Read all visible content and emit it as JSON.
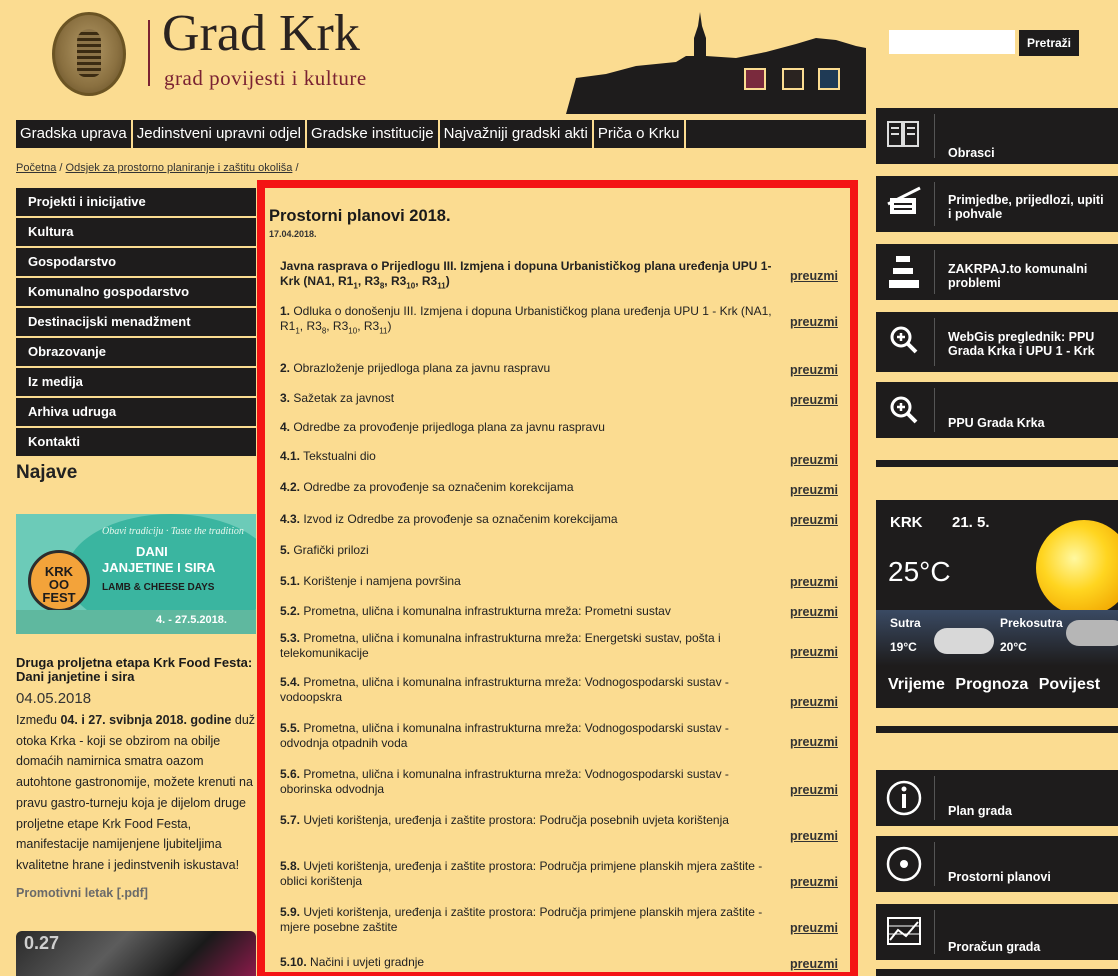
{
  "site": {
    "title": "Grad Krk",
    "subtitle": "grad povijesti i kulture",
    "theme_colors": [
      "#7a2a3d",
      "#2a2320",
      "#1f3a55"
    ]
  },
  "search": {
    "placeholder": "",
    "button_label": "Pretraži"
  },
  "topnav": [
    "Gradska uprava",
    "Jedinstveni upravni odjel",
    "Gradske institucije",
    "Najvažniji gradski akti",
    "Priča o Krku"
  ],
  "breadcrumb": {
    "home": "Početna",
    "section": "Odsjek za prostorno planiranje i zaštitu okoliša",
    "sep": " / ",
    "trail": " /"
  },
  "sidemenu": [
    "Projekti i inicijative",
    "Kultura",
    "Gospodarstvo",
    "Komunalno gospodarstvo",
    "Destinacijski menadžment",
    "Obrazovanje",
    "Iz medija",
    "Arhiva udruga",
    "Kontakti"
  ],
  "najave": {
    "heading": "Najave",
    "promo": {
      "script": "Obavi tradiciju · Taste the tradition",
      "line1": "DANI",
      "line2": "JANJETINE I SIRA",
      "line3": "LAMB & CHEESE DAYS",
      "pot": "KRK\nOO\nFEST",
      "dates": "4. - 27.5.2018."
    },
    "news_title": "Druga proljetna etapa Krk Food Festa: Dani janjetine i sira",
    "news_date": "04.05.2018",
    "news_body_pre": "Između ",
    "news_body_bold": "04. i 27. svibnja 2018. godine",
    "news_body_post": " duž otoka Krka - koji se obzirom na obilje domaćih namirnica smatra oazom autohtone gastronomije, možete krenuti na pravu gastro-turneju koja je dijelom druge proljetne etape Krk Food Festa, manifestacije namijenjene ljubiteljima kvalitetne hrane i jedinstvenih iskustava!",
    "promo_link": "Promotivni letak [.pdf]",
    "second_image_text": "0.27"
  },
  "main": {
    "heading": "Prostorni planovi 2018.",
    "date": "17.04.2018.",
    "download_label": "preuzmi",
    "items": [
      {
        "num": "",
        "text": "Javna rasprava o Prijedlogu III. Izmjena i dopuna Urbanističkog plana uređenja UPU 1- Krk (NA1, R1",
        "bold": true,
        "link": true,
        "sub_html": "Javna rasprava o Prijedlogu III. Izmjena i dopuna Urbanističkog plana uređenja UPU 1- Krk (NA1, R1<sub>1</sub>, R3<sub>8</sub>, R3<sub>10</sub>, R3<sub>11</sub>)"
      },
      {
        "num": "1.",
        "text": " Odluka o donošenju III. Izmjena i dopuna Urbanističkog plana uređenja UPU 1 - Krk (NA1, R1",
        "link": true,
        "sub_html": " Odluka o donošenju III. Izmjena i dopuna Urbanističkog plana uređenja UPU 1 - Krk (NA1, R1<sub>1</sub>, R3<sub>8</sub>, R3<sub>10</sub>, R3<sub>11</sub>)"
      },
      {
        "num": "2.",
        "text": " Obrazloženje prijedloga plana za javnu raspravu",
        "link": true
      },
      {
        "num": "3.",
        "text": " Sažetak za javnost",
        "link": true
      },
      {
        "num": "4.",
        "text": " Odredbe za provođenje prijedloga plana za javnu raspravu",
        "link": false
      },
      {
        "num": "4.1.",
        "text": " Tekstualni dio",
        "link": true
      },
      {
        "num": "4.2.",
        "text": " Odredbe za provođenje sa označenim korekcijama",
        "link": true
      },
      {
        "num": "4.3.",
        "text": " Izvod iz Odredbe za provođenje sa označenim korekcijama",
        "link": true
      },
      {
        "num": "5.",
        "text": " Grafički prilozi",
        "link": false
      },
      {
        "num": "5.1.",
        "text": " Korištenje i namjena površina",
        "link": true
      },
      {
        "num": "5.2.",
        "text": " Prometna, ulična i komunalna infrastrukturna mreža: Prometni sustav",
        "link": true
      },
      {
        "num": "5.3.",
        "text": " Prometna, ulična i komunalna infrastrukturna mreža: Energetski sustav, pošta i telekomunikacije",
        "link": true
      },
      {
        "num": "5.4.",
        "text": " Prometna, ulična i komunalna infrastrukturna mreža: Vodnogospodarski sustav - vodoopskra",
        "link": true
      },
      {
        "num": "5.5.",
        "text": " Prometna, ulična i komunalna infrastrukturna mreža: Vodnogospodarski sustav - odvodnja otpadnih voda",
        "link": true
      },
      {
        "num": "5.6.",
        "text": " Prometna, ulična i komunalna infrastrukturna mreža: Vodnogospodarski sustav - oborinska odvodnja",
        "link": true
      },
      {
        "num": "5.7.",
        "text": " Uvjeti korištenja, uređenja i zaštite prostora: Područja posebnih uvjeta korištenja",
        "link": true
      },
      {
        "num": "5.8.",
        "text": " Uvjeti korištenja, uređenja i zaštite prostora: Područja primjene planskih mjera zaštite - oblici korištenja",
        "link": true
      },
      {
        "num": "5.9.",
        "text": " Uvjeti korištenja, uređenja i zaštite prostora: Područja primjene planskih mjera zaštite - mjere posebne zaštite",
        "link": true
      },
      {
        "num": "5.10.",
        "text": " Načini i uvjeti gradnje",
        "link": true
      }
    ]
  },
  "right": {
    "boxes": [
      {
        "label": "Obrasci",
        "icon": "forms-icon"
      },
      {
        "label": "Primjedbe, prijedlozi, upiti i pohvale",
        "icon": "notes-icon"
      },
      {
        "label": "ZAKRPAJ.to komunalni problemi",
        "icon": "traffic-cone-icon"
      },
      {
        "label": "WebGis preglednik: PPU Grada Krka i UPU 1 - Krk",
        "icon": "zoom-icon"
      },
      {
        "label": "PPU Grada Krka",
        "icon": "zoom-icon"
      }
    ],
    "weather": {
      "city": "KRK",
      "date": "21. 5.",
      "temp": "25°C",
      "tomorrow_label": "Sutra",
      "tomorrow_temp": "19°C",
      "dayafter_label": "Prekosutra",
      "dayafter_temp": "20°C",
      "links": [
        "Vrijeme",
        "Prognoza",
        "Povijest"
      ]
    },
    "bottom_boxes": [
      {
        "label": "Plan grada",
        "icon": "info-icon"
      },
      {
        "label": "Prostorni planovi",
        "icon": "target-icon"
      },
      {
        "label": "Proračun grada",
        "icon": "chart-icon"
      }
    ]
  }
}
